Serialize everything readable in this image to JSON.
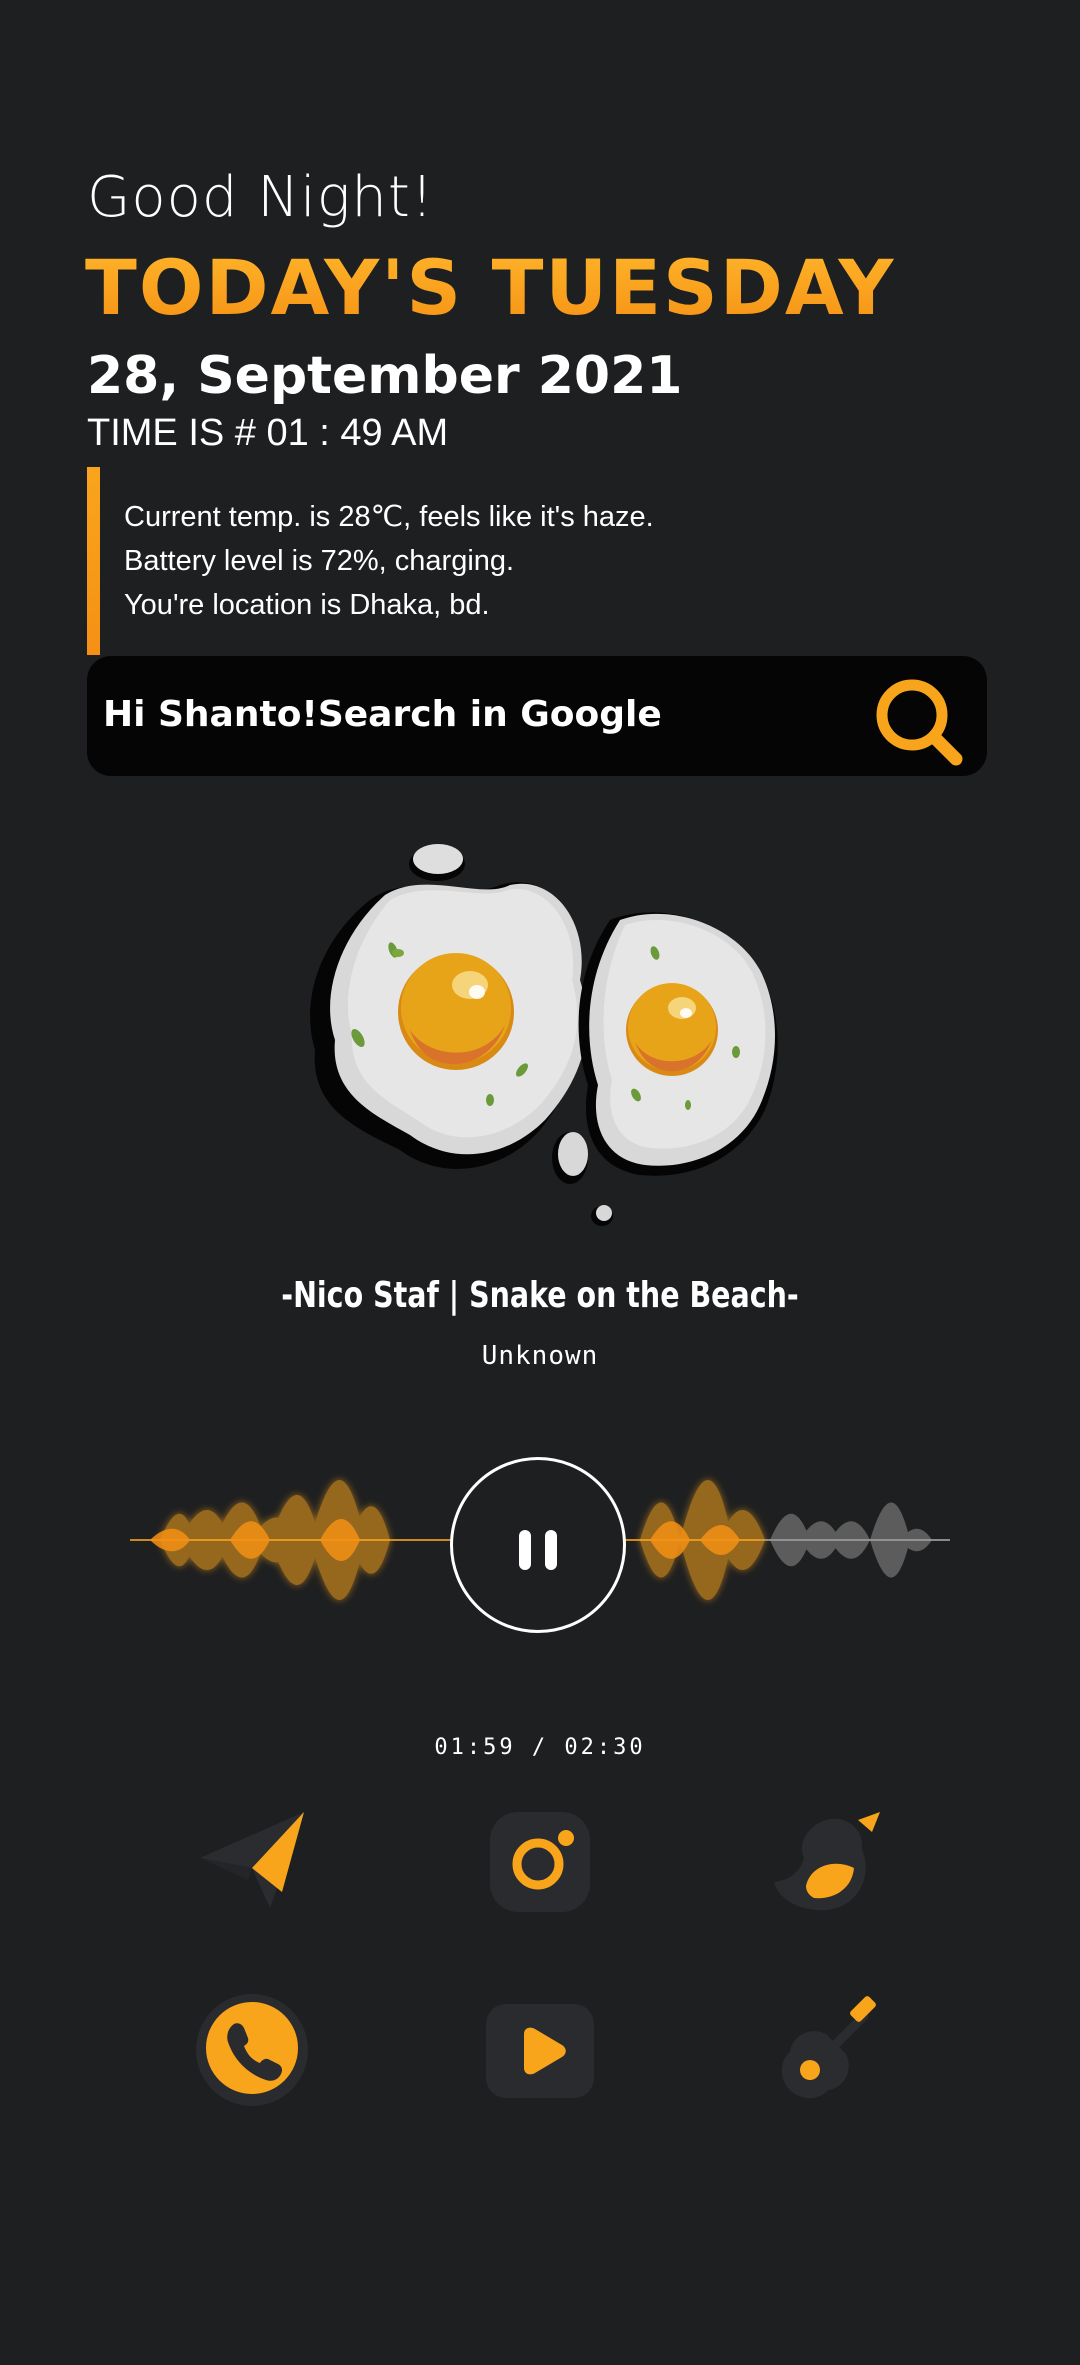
{
  "header": {
    "greeting": "Good Night!",
    "day": "TODAY'S TUESDAY",
    "date": "28, September 2021",
    "time": "TIME IS # 01 : 49 AM"
  },
  "info": {
    "lines": [
      "Current temp. is 28℃, feels like it's haze.",
      "Battery level is 72%, charging.",
      "You're location is Dhaka, bd."
    ]
  },
  "search": {
    "label": "Hi Shanto!Search in Google",
    "icon": "search-icon"
  },
  "player": {
    "title": "-Nico Staf | Snake on the Beach-",
    "artist": "Unknown",
    "time": "01:59 / 02:30",
    "progress": 0.79,
    "state": "playing",
    "control_icon": "pause-icon"
  },
  "apps": [
    {
      "name": "telegram",
      "icon": "paper-plane-icon"
    },
    {
      "name": "camera",
      "icon": "camera-icon"
    },
    {
      "name": "twitter",
      "icon": "bird-icon"
    },
    {
      "name": "phone",
      "icon": "phone-icon"
    },
    {
      "name": "video",
      "icon": "play-icon"
    },
    {
      "name": "music",
      "icon": "guitar-icon"
    }
  ],
  "colors": {
    "background": "#1e1f21",
    "accent": "#f9a51c",
    "accent_dark": "#f59015",
    "text": "#ffffff",
    "search_bg": "#050505",
    "icon_bg": "#2a2b2e"
  }
}
